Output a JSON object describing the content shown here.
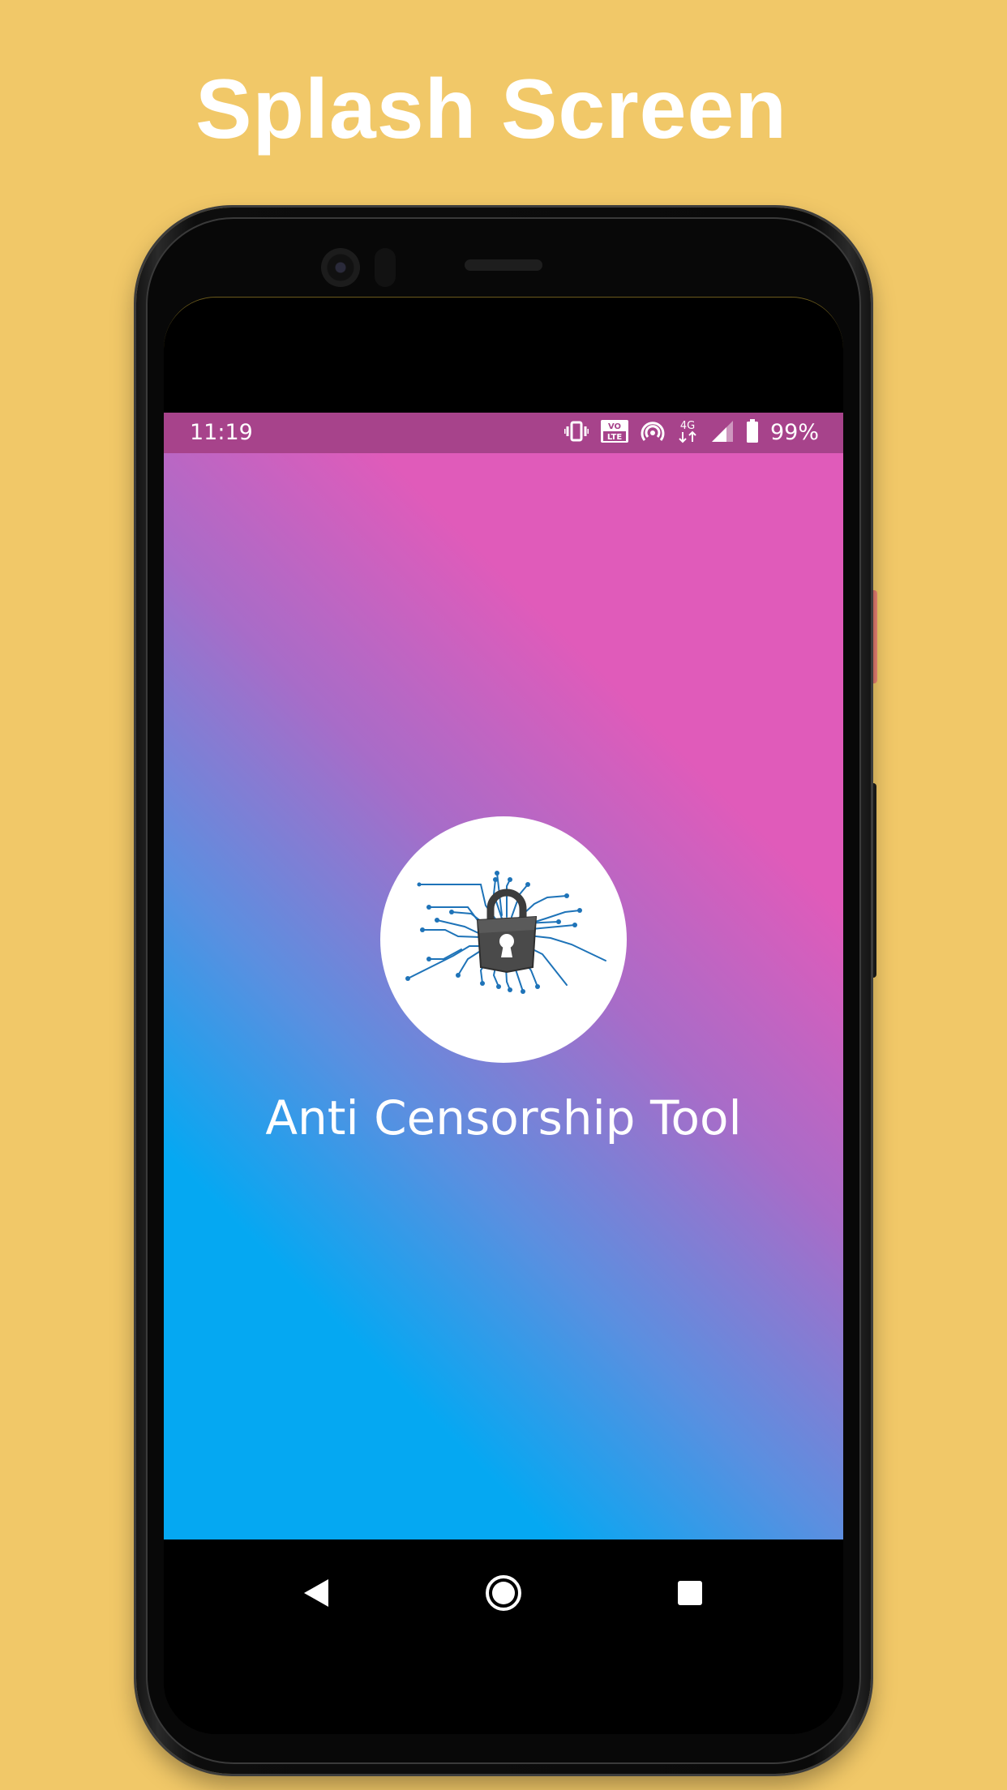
{
  "headline": "Splash Screen",
  "status_bar": {
    "time": "11:19",
    "icons": [
      "vibrate-icon",
      "volte-icon",
      "hotspot-icon",
      "4g-data-icon",
      "signal-icon",
      "battery-icon"
    ],
    "volte_top": "VO",
    "volte_bottom": "LTE",
    "data_type": "4G",
    "battery_percent": "99%"
  },
  "app": {
    "name": "Anti Censorship Tool",
    "logo": "circuit-padlock-logo"
  },
  "nav_bar": {
    "buttons": [
      "back-icon",
      "home-icon",
      "recents-icon"
    ]
  },
  "colors": {
    "background": "#F1C868",
    "status_bar": "#A7438B",
    "gradient_pink": "#E05BBA",
    "gradient_purple": "#A86CC8",
    "gradient_blue": "#05A8F2"
  }
}
